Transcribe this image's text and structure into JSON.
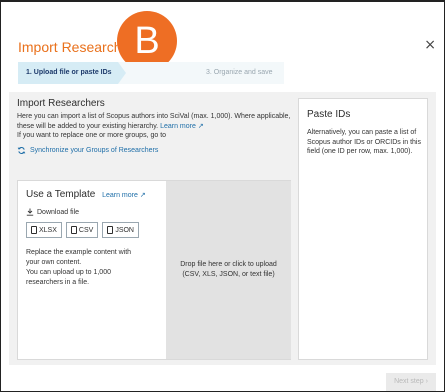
{
  "dialog": {
    "title": "Import Researchers",
    "badge_letter": "B",
    "close_label": "×"
  },
  "steps": [
    {
      "label": "1. Upload file or paste IDs",
      "state": "active"
    },
    {
      "label": "",
      "state": "next"
    },
    {
      "label": "3. Organize and save",
      "state": "disabled"
    }
  ],
  "left_panel": {
    "heading": "Import Researchers",
    "description": "Here you can import a list of Scopus authors into SciVal (max. 1,000). Where applicable, these will be added to your existing hierarchy.",
    "learn_more": "Learn more ↗",
    "replace_text": "If you want to replace one or more groups, go to",
    "sync_link": "Synchronize your Groups of Researchers"
  },
  "template": {
    "heading": "Use a Template",
    "learn_more": "Learn more ↗",
    "download_label": "Download file",
    "formats": [
      "XLSX",
      "CSV",
      "JSON"
    ],
    "text_line1": "Replace the example content with your own content.",
    "text_line2": "You can upload up to 1,000 researchers in a file."
  },
  "dropzone": {
    "line1": "Drop file here or click to upload",
    "line2": "(CSV, XLS, JSON, or text file)"
  },
  "right_panel": {
    "heading": "Paste IDs",
    "description": "Alternatively, you can paste a list of Scopus author IDs or ORCIDs in this field (one ID per row, max. 1,000)."
  },
  "footer": {
    "next_label": "Next step ›"
  },
  "colors": {
    "accent": "#e9711c",
    "link": "#1e6ea8",
    "active_step": "#d6ecf5"
  }
}
